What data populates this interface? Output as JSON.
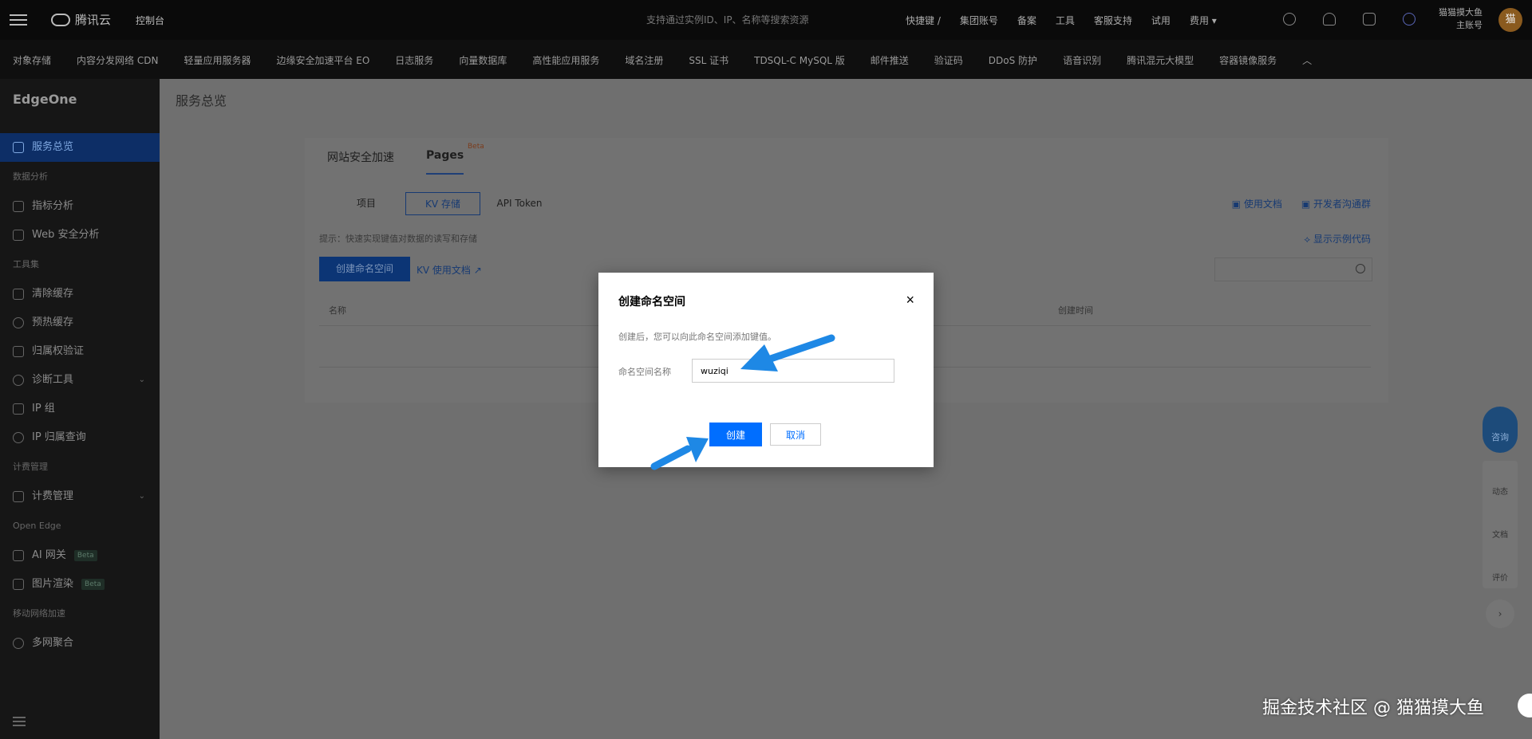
{
  "topbar": {
    "logo": "腾讯云",
    "console": "控制台",
    "search_placeholder": "支持通过实例ID、IP、名称等搜索资源",
    "nav": [
      "快捷键 /",
      "集团账号",
      "备案",
      "工具",
      "客服支持",
      "试用",
      "费用 ▾"
    ],
    "user_name": "猫猫摸大鱼",
    "user_role": "主账号",
    "avatar_text": "猫"
  },
  "prodbar": {
    "items": [
      "对象存储",
      "内容分发网络 CDN",
      "轻量应用服务器",
      "边缘安全加速平台 EO",
      "日志服务",
      "向量数据库",
      "高性能应用服务",
      "域名注册",
      "SSL 证书",
      "TDSQL-C MySQL 版",
      "邮件推送",
      "验证码",
      "DDoS 防护",
      "语音识别",
      "腾讯混元大模型",
      "容器镜像服务"
    ],
    "collapse": "︿"
  },
  "sidebar": {
    "brand": "EdgeOne",
    "overview": "服务总览",
    "sec_data": "数据分析",
    "metrics": "指标分析",
    "websec": "Web 安全分析",
    "sec_tools": "工具集",
    "purge": "清除缓存",
    "prefetch": "预热缓存",
    "auth": "归属权验证",
    "diag": "诊断工具",
    "ipgroup": "IP 组",
    "iplookup": "IP 归属查询",
    "sec_billing": "计费管理",
    "billing": "计费管理",
    "sec_open": "Open Edge",
    "aigw": "AI 网关",
    "img": "图片渲染",
    "beta": "Beta",
    "sec_mobile": "移动网络加速",
    "multinet": "多网聚合"
  },
  "main": {
    "title": "服务总览",
    "tab_site": "网站安全加速",
    "tab_pages": "Pages",
    "tab_beta": "Beta",
    "sub_project": "项目",
    "sub_kv": "KV 存储",
    "sub_token": "API Token",
    "doc_link": "使用文档",
    "dev_link": "开发者沟通群",
    "hint": "提示：快速实现键值对数据的读写和存储",
    "show_code": "显示示例代码",
    "create_ns_btn": "创建命名空间",
    "kv_doc": "KV 使用文档",
    "col_name": "名称",
    "col_time": "创建时间"
  },
  "modal": {
    "title": "创建命名空间",
    "close": "×",
    "desc": "创建后，您可以向此命名空间添加键值。",
    "label": "命名空间名称",
    "value": "wuziqi",
    "ok": "创建",
    "cancel": "取消"
  },
  "float": {
    "consult": "咨询",
    "updates": "动态",
    "docs": "文档",
    "feedback": "评价",
    "more": "›"
  },
  "watermark": "掘金技术社区 @ 猫猫摸大鱼",
  "colors": {
    "primary": "#006eff",
    "arrow": "#1e88e5"
  }
}
